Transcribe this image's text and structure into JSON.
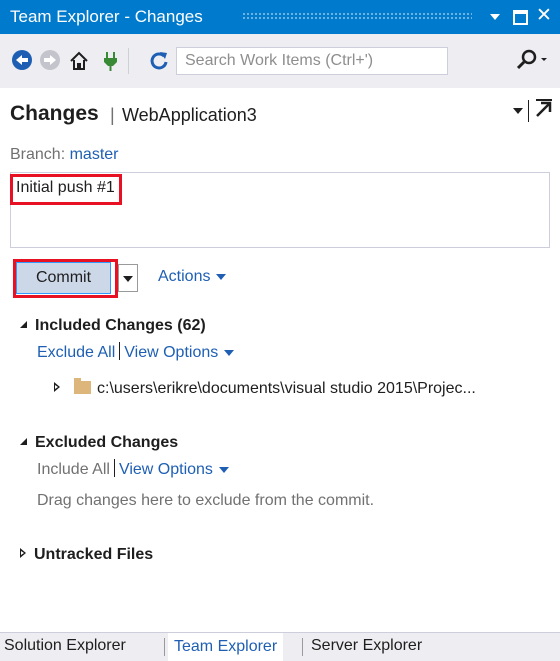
{
  "window": {
    "title": "Team Explorer - Changes"
  },
  "toolbar": {
    "search_placeholder": "Search Work Items (Ctrl+')"
  },
  "header": {
    "title": "Changes",
    "separator": "|",
    "project": "WebApplication3"
  },
  "branch": {
    "label": "Branch:",
    "value": "master"
  },
  "commit_message": "Initial push #1",
  "commit": {
    "button_label": "Commit",
    "actions_label": "Actions"
  },
  "included": {
    "header": "Included Changes (62)",
    "exclude_all": "Exclude All",
    "view_options": "View Options",
    "file_path": "c:\\users\\erikre\\documents\\visual studio 2015\\Projec..."
  },
  "excluded": {
    "header": "Excluded Changes",
    "include_all": "Include All",
    "view_options": "View Options",
    "hint": "Drag changes here to exclude from the commit."
  },
  "untracked": {
    "header": "Untracked Files"
  },
  "bottom_tabs": [
    {
      "label": "Solution Explorer",
      "active": false
    },
    {
      "label": "Team Explorer",
      "active": true
    },
    {
      "label": "Server Explorer",
      "active": false
    }
  ],
  "colors": {
    "accent": "#007acc",
    "link": "#1e5fb4",
    "highlight": "#e81123"
  }
}
